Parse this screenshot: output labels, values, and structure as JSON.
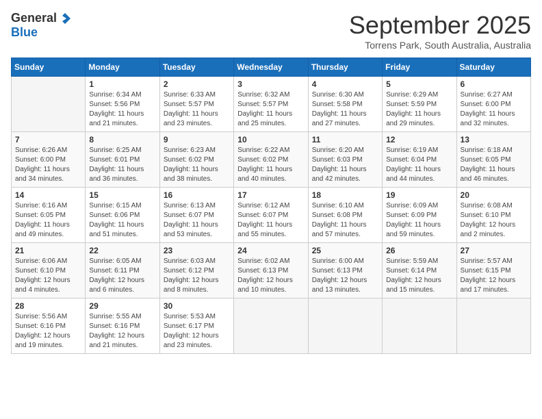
{
  "logo": {
    "general": "General",
    "blue": "Blue"
  },
  "header": {
    "month": "September 2025",
    "location": "Torrens Park, South Australia, Australia"
  },
  "days_of_week": [
    "Sunday",
    "Monday",
    "Tuesday",
    "Wednesday",
    "Thursday",
    "Friday",
    "Saturday"
  ],
  "weeks": [
    [
      {
        "day": "",
        "sunrise": "",
        "sunset": "",
        "daylight": ""
      },
      {
        "day": "1",
        "sunrise": "Sunrise: 6:34 AM",
        "sunset": "Sunset: 5:56 PM",
        "daylight": "Daylight: 11 hours and 21 minutes."
      },
      {
        "day": "2",
        "sunrise": "Sunrise: 6:33 AM",
        "sunset": "Sunset: 5:57 PM",
        "daylight": "Daylight: 11 hours and 23 minutes."
      },
      {
        "day": "3",
        "sunrise": "Sunrise: 6:32 AM",
        "sunset": "Sunset: 5:57 PM",
        "daylight": "Daylight: 11 hours and 25 minutes."
      },
      {
        "day": "4",
        "sunrise": "Sunrise: 6:30 AM",
        "sunset": "Sunset: 5:58 PM",
        "daylight": "Daylight: 11 hours and 27 minutes."
      },
      {
        "day": "5",
        "sunrise": "Sunrise: 6:29 AM",
        "sunset": "Sunset: 5:59 PM",
        "daylight": "Daylight: 11 hours and 29 minutes."
      },
      {
        "day": "6",
        "sunrise": "Sunrise: 6:27 AM",
        "sunset": "Sunset: 6:00 PM",
        "daylight": "Daylight: 11 hours and 32 minutes."
      }
    ],
    [
      {
        "day": "7",
        "sunrise": "Sunrise: 6:26 AM",
        "sunset": "Sunset: 6:00 PM",
        "daylight": "Daylight: 11 hours and 34 minutes."
      },
      {
        "day": "8",
        "sunrise": "Sunrise: 6:25 AM",
        "sunset": "Sunset: 6:01 PM",
        "daylight": "Daylight: 11 hours and 36 minutes."
      },
      {
        "day": "9",
        "sunrise": "Sunrise: 6:23 AM",
        "sunset": "Sunset: 6:02 PM",
        "daylight": "Daylight: 11 hours and 38 minutes."
      },
      {
        "day": "10",
        "sunrise": "Sunrise: 6:22 AM",
        "sunset": "Sunset: 6:02 PM",
        "daylight": "Daylight: 11 hours and 40 minutes."
      },
      {
        "day": "11",
        "sunrise": "Sunrise: 6:20 AM",
        "sunset": "Sunset: 6:03 PM",
        "daylight": "Daylight: 11 hours and 42 minutes."
      },
      {
        "day": "12",
        "sunrise": "Sunrise: 6:19 AM",
        "sunset": "Sunset: 6:04 PM",
        "daylight": "Daylight: 11 hours and 44 minutes."
      },
      {
        "day": "13",
        "sunrise": "Sunrise: 6:18 AM",
        "sunset": "Sunset: 6:05 PM",
        "daylight": "Daylight: 11 hours and 46 minutes."
      }
    ],
    [
      {
        "day": "14",
        "sunrise": "Sunrise: 6:16 AM",
        "sunset": "Sunset: 6:05 PM",
        "daylight": "Daylight: 11 hours and 49 minutes."
      },
      {
        "day": "15",
        "sunrise": "Sunrise: 6:15 AM",
        "sunset": "Sunset: 6:06 PM",
        "daylight": "Daylight: 11 hours and 51 minutes."
      },
      {
        "day": "16",
        "sunrise": "Sunrise: 6:13 AM",
        "sunset": "Sunset: 6:07 PM",
        "daylight": "Daylight: 11 hours and 53 minutes."
      },
      {
        "day": "17",
        "sunrise": "Sunrise: 6:12 AM",
        "sunset": "Sunset: 6:07 PM",
        "daylight": "Daylight: 11 hours and 55 minutes."
      },
      {
        "day": "18",
        "sunrise": "Sunrise: 6:10 AM",
        "sunset": "Sunset: 6:08 PM",
        "daylight": "Daylight: 11 hours and 57 minutes."
      },
      {
        "day": "19",
        "sunrise": "Sunrise: 6:09 AM",
        "sunset": "Sunset: 6:09 PM",
        "daylight": "Daylight: 11 hours and 59 minutes."
      },
      {
        "day": "20",
        "sunrise": "Sunrise: 6:08 AM",
        "sunset": "Sunset: 6:10 PM",
        "daylight": "Daylight: 12 hours and 2 minutes."
      }
    ],
    [
      {
        "day": "21",
        "sunrise": "Sunrise: 6:06 AM",
        "sunset": "Sunset: 6:10 PM",
        "daylight": "Daylight: 12 hours and 4 minutes."
      },
      {
        "day": "22",
        "sunrise": "Sunrise: 6:05 AM",
        "sunset": "Sunset: 6:11 PM",
        "daylight": "Daylight: 12 hours and 6 minutes."
      },
      {
        "day": "23",
        "sunrise": "Sunrise: 6:03 AM",
        "sunset": "Sunset: 6:12 PM",
        "daylight": "Daylight: 12 hours and 8 minutes."
      },
      {
        "day": "24",
        "sunrise": "Sunrise: 6:02 AM",
        "sunset": "Sunset: 6:13 PM",
        "daylight": "Daylight: 12 hours and 10 minutes."
      },
      {
        "day": "25",
        "sunrise": "Sunrise: 6:00 AM",
        "sunset": "Sunset: 6:13 PM",
        "daylight": "Daylight: 12 hours and 13 minutes."
      },
      {
        "day": "26",
        "sunrise": "Sunrise: 5:59 AM",
        "sunset": "Sunset: 6:14 PM",
        "daylight": "Daylight: 12 hours and 15 minutes."
      },
      {
        "day": "27",
        "sunrise": "Sunrise: 5:57 AM",
        "sunset": "Sunset: 6:15 PM",
        "daylight": "Daylight: 12 hours and 17 minutes."
      }
    ],
    [
      {
        "day": "28",
        "sunrise": "Sunrise: 5:56 AM",
        "sunset": "Sunset: 6:16 PM",
        "daylight": "Daylight: 12 hours and 19 minutes."
      },
      {
        "day": "29",
        "sunrise": "Sunrise: 5:55 AM",
        "sunset": "Sunset: 6:16 PM",
        "daylight": "Daylight: 12 hours and 21 minutes."
      },
      {
        "day": "30",
        "sunrise": "Sunrise: 5:53 AM",
        "sunset": "Sunset: 6:17 PM",
        "daylight": "Daylight: 12 hours and 23 minutes."
      },
      {
        "day": "",
        "sunrise": "",
        "sunset": "",
        "daylight": ""
      },
      {
        "day": "",
        "sunrise": "",
        "sunset": "",
        "daylight": ""
      },
      {
        "day": "",
        "sunrise": "",
        "sunset": "",
        "daylight": ""
      },
      {
        "day": "",
        "sunrise": "",
        "sunset": "",
        "daylight": ""
      }
    ]
  ]
}
